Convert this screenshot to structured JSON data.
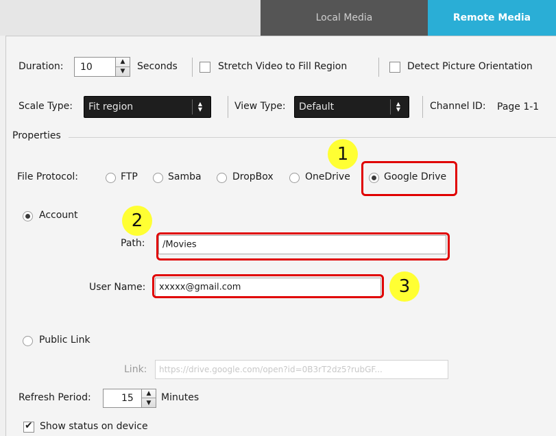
{
  "tabs": [
    {
      "label": "Local Media",
      "active": false
    },
    {
      "label": "Remote Media",
      "active": true
    }
  ],
  "top_row": {
    "duration_label": "Duration:",
    "duration_value": "10",
    "seconds_label": "Seconds",
    "stretch_label": "Stretch Video to Fill Region",
    "detect_label": "Detect Picture Orientation"
  },
  "second_row": {
    "scale_label": "Scale Type:",
    "scale_value": "Fit region",
    "view_label": "View Type:",
    "view_value": "Default",
    "channel_label": "Channel ID:",
    "channel_value": "Page 1-1"
  },
  "properties": {
    "heading": "Properties",
    "protocol_label": "File Protocol:",
    "protocols": [
      "FTP",
      "Samba",
      "DropBox",
      "OneDrive",
      "Google Drive"
    ],
    "selected_protocol": "Google Drive",
    "account_label": "Account",
    "path_label": "Path:",
    "path_value": "/Movies",
    "username_label": "User Name:",
    "username_value": "xxxxx@gmail.com",
    "public_link_label": "Public Link",
    "link_label": "Link:",
    "link_value": "https://drive.google.com/open?id=0B3rT2dz5?rubGF...",
    "refresh_label": "Refresh Period:",
    "refresh_value": "15",
    "minutes_label": "Minutes",
    "show_status_label": "Show status on device",
    "show_status_checked": true
  },
  "annotations": {
    "step1": "1",
    "step2": "2",
    "step3": "3"
  },
  "colors": {
    "highlight": "#e00000",
    "badge": "#ffff33",
    "active_tab": "#2aaed6",
    "inactive_tab": "#555555"
  }
}
